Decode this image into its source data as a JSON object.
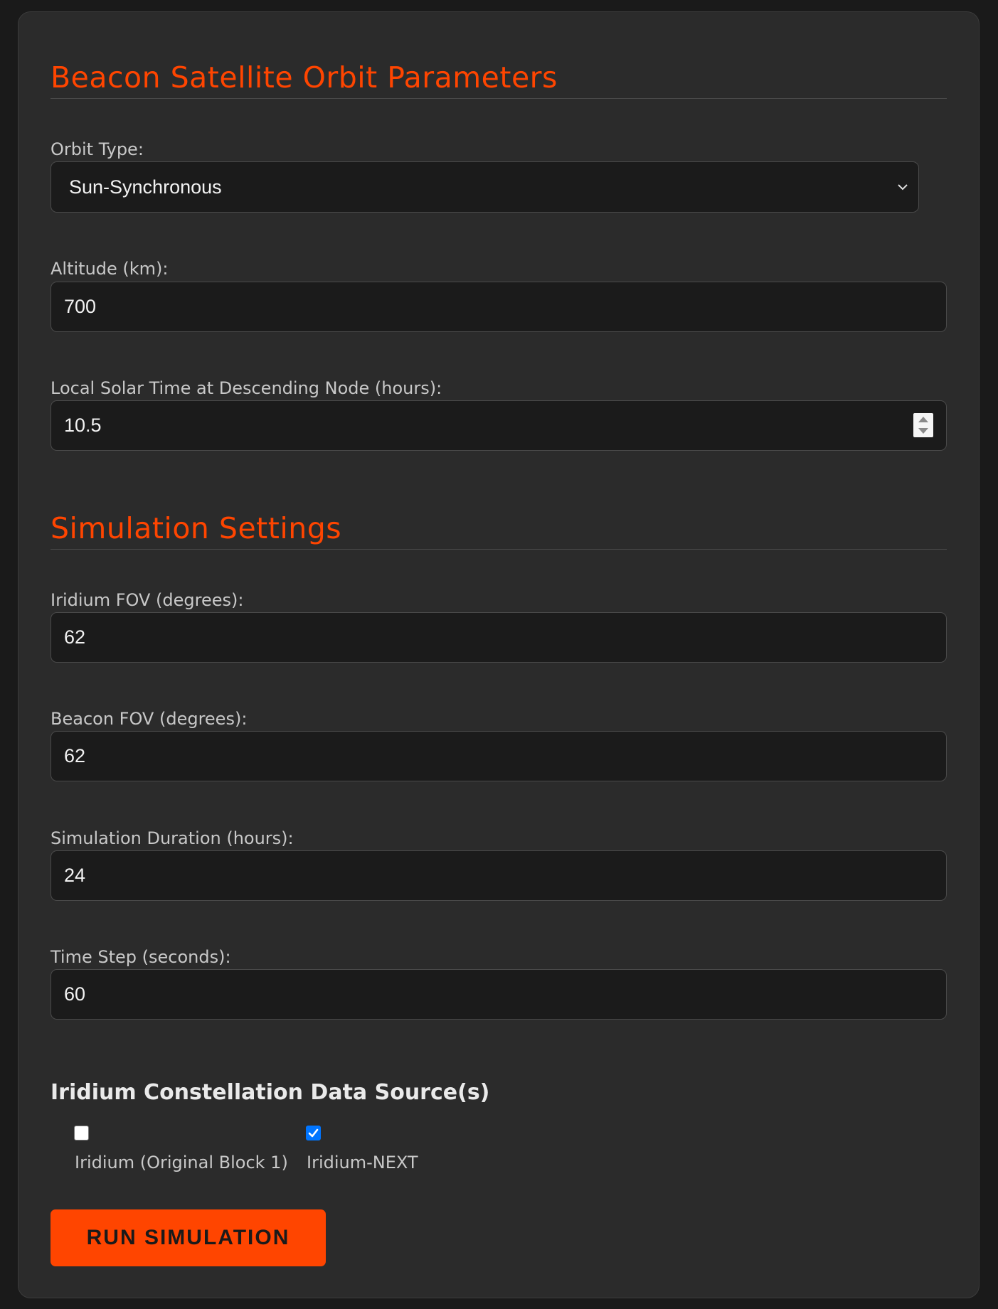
{
  "orbit_section": {
    "title": "Beacon Satellite Orbit Parameters",
    "orbit_type": {
      "label": "Orbit Type:",
      "selected": "Sun-Synchronous"
    },
    "altitude": {
      "label": "Altitude (km):",
      "value": "700"
    },
    "local_solar_time": {
      "label": "Local Solar Time at Descending Node (hours):",
      "value": "10.5"
    }
  },
  "simulation_section": {
    "title": "Simulation Settings",
    "iridium_fov": {
      "label": "Iridium FOV (degrees):",
      "value": "62"
    },
    "beacon_fov": {
      "label": "Beacon FOV (degrees):",
      "value": "62"
    },
    "duration": {
      "label": "Simulation Duration (hours):",
      "value": "24"
    },
    "time_step": {
      "label": "Time Step (seconds):",
      "value": "60"
    }
  },
  "data_sources": {
    "title": "Iridium Constellation Data Source(s)",
    "options": [
      {
        "label": "Iridium (Original Block 1)",
        "checked": false
      },
      {
        "label": "Iridium-NEXT",
        "checked": true
      }
    ]
  },
  "run_button": {
    "label": "RUN SIMULATION"
  },
  "colors": {
    "accent": "#ff4500",
    "panel": "#2b2b2b",
    "background": "#1a1a1a",
    "input_bg": "#1b1b1b",
    "checkbox_checked": "#0075ff"
  },
  "icons": {
    "select_indicator": "chevron-down-icon",
    "number_spinner": "spinner-arrows-icon",
    "checkmark": "checkmark-icon"
  }
}
